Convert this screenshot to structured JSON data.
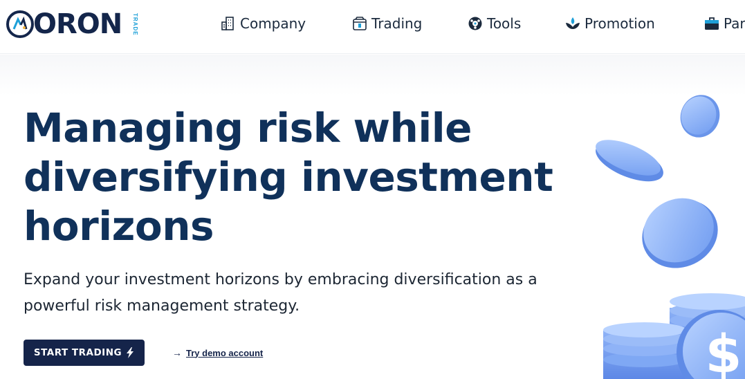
{
  "brand": {
    "name": "ORON",
    "tag": "TRADE"
  },
  "nav": {
    "items": [
      {
        "label": "Company",
        "icon": "building-icon"
      },
      {
        "label": "Trading",
        "icon": "box-icon"
      },
      {
        "label": "Tools",
        "icon": "ball-icon"
      },
      {
        "label": "Promotion",
        "icon": "lotus-icon"
      },
      {
        "label": "Par",
        "icon": "briefcase-icon"
      }
    ]
  },
  "hero": {
    "title_lines": [
      "Managing risk while",
      "diversifying investment",
      "horizons"
    ],
    "subtitle_lines": [
      "Expand your investment horizons by embracing diversification as a",
      "powerful risk management strategy."
    ],
    "primary_button": "START TRADING",
    "demo_link": "Try demo account",
    "illustration": "coins-illustration",
    "coin_symbol": "$"
  },
  "colors": {
    "brand_navy": "#15244a",
    "heading": "#10315a",
    "accent_cyan": "#1ea0d8",
    "coin_blue": "#7fa8f4"
  }
}
